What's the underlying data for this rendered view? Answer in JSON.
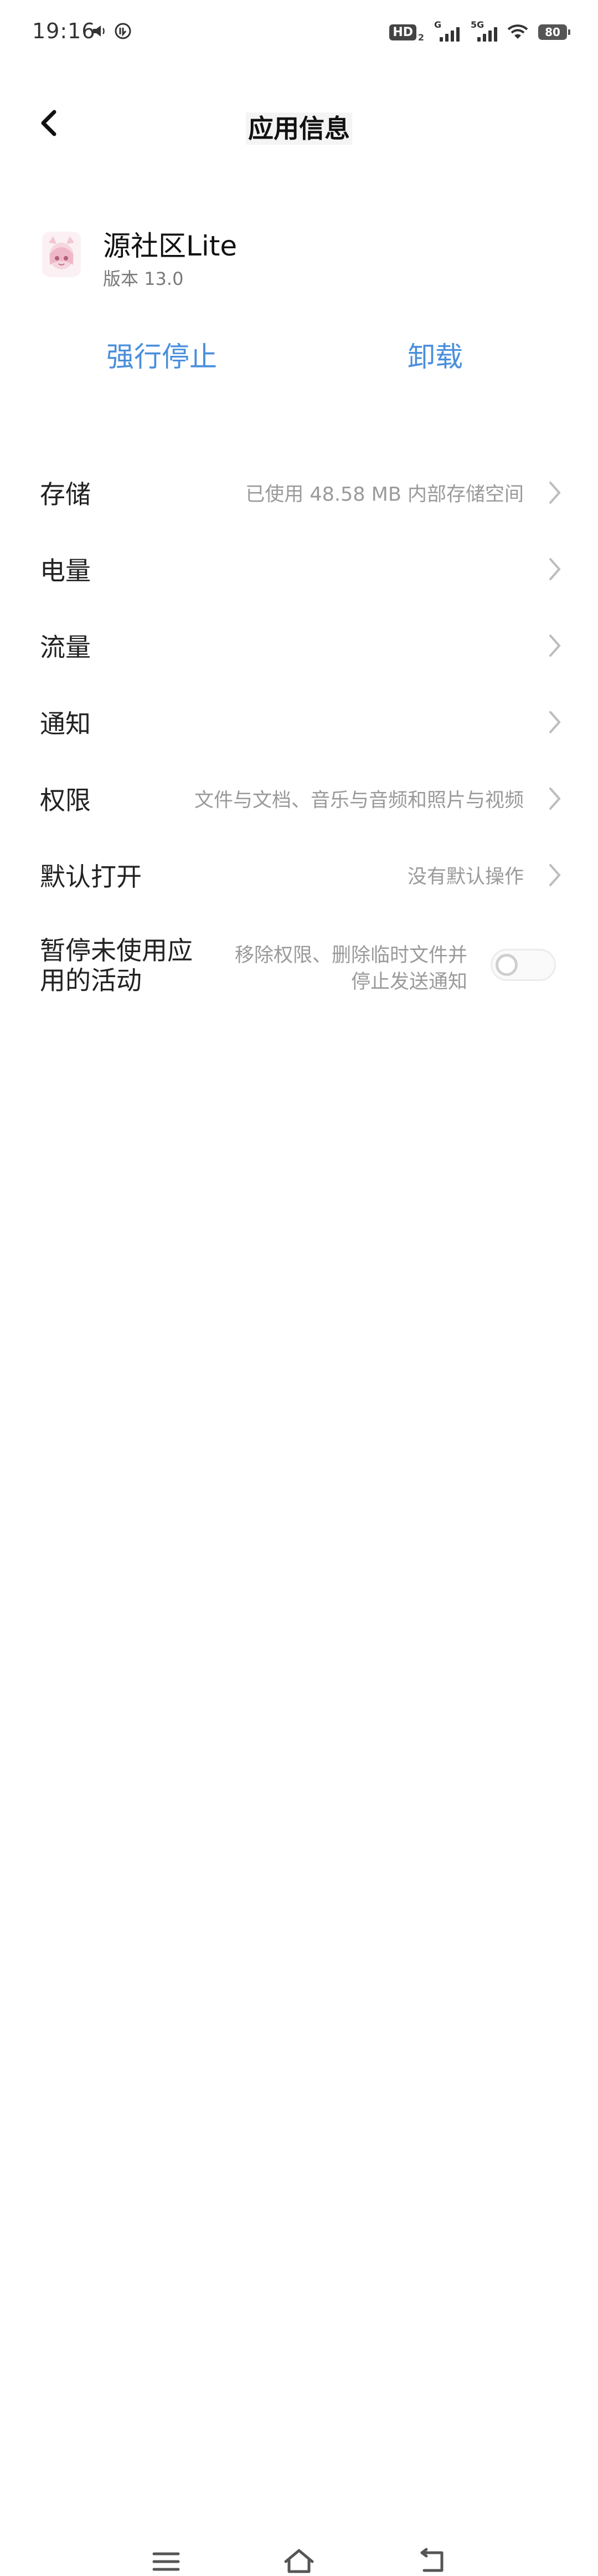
{
  "status_bar": {
    "time": "19:16",
    "hd_label": "HD",
    "hd_sub": "2",
    "signal1_label": "G",
    "signal2_label": "5G",
    "battery": "80"
  },
  "header": {
    "back_icon": "chevron-left-icon",
    "title": "应用信息"
  },
  "app": {
    "name": "源社区Lite",
    "version": "版本 13.0"
  },
  "actions": {
    "force_stop": "强行停止",
    "uninstall": "卸载",
    "accent_color": "#4a8fdc"
  },
  "settings": [
    {
      "label": "存储",
      "value": "已使用 48.58 MB 内部存储空间"
    },
    {
      "label": "电量",
      "value": ""
    },
    {
      "label": "流量",
      "value": ""
    },
    {
      "label": "通知",
      "value": ""
    },
    {
      "label": "权限",
      "value": "文件与文档、音乐与音频和照片与视频"
    },
    {
      "label": "默认打开",
      "value": "没有默认操作"
    }
  ],
  "pause_unused": {
    "label": "暂停未使用应用的活动",
    "description": "移除权限、删除临时文件并停止发送通知",
    "enabled": false
  },
  "nav_bar": {
    "menu_icon": "menu-icon",
    "home_icon": "home-icon",
    "back_icon": "back-icon"
  }
}
